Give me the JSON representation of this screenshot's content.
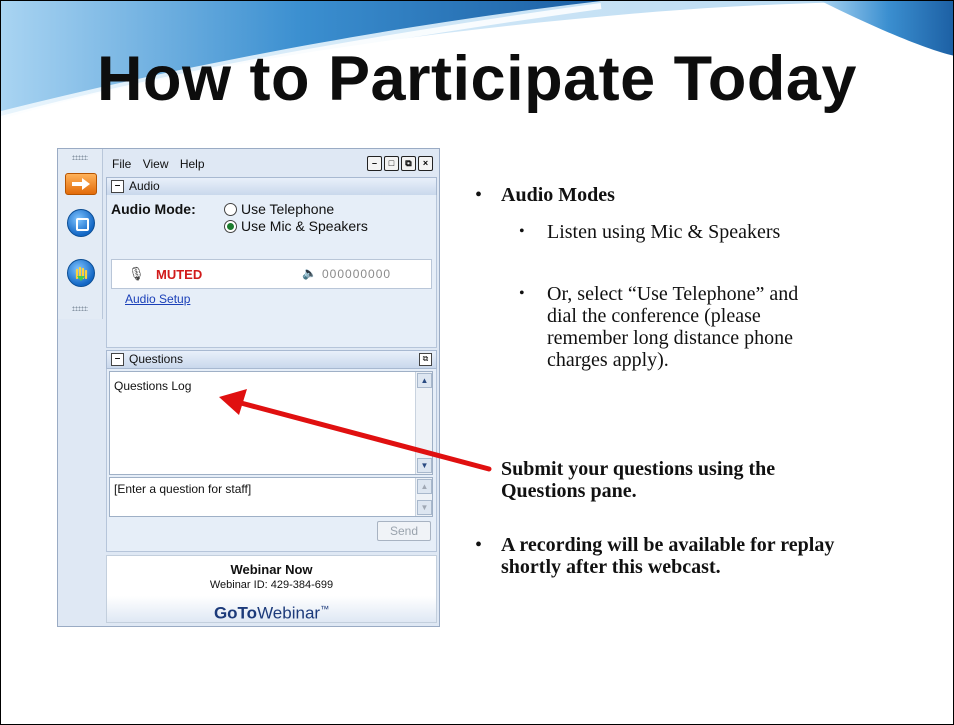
{
  "slide": {
    "title": "How to Participate Today"
  },
  "app": {
    "menu": [
      "File",
      "View",
      "Help"
    ],
    "window_buttons": [
      "minimize",
      "restore",
      "popout",
      "close"
    ],
    "audio_section": {
      "header": "Audio",
      "mode_label": "Audio Mode:",
      "options": [
        "Use Telephone",
        "Use Mic & Speakers"
      ],
      "selected_option": "Use Mic & Speakers",
      "mic_status": "MUTED",
      "pin": "000000000",
      "setup_link": "Audio Setup"
    },
    "questions_section": {
      "header": "Questions",
      "log_text": "Questions Log",
      "input_placeholder": "[Enter a question for staff]",
      "send_label": "Send"
    },
    "footer": {
      "status": "Webinar Now",
      "webinar_id": "Webinar ID: 429-384-699",
      "brand_bold": "GoTo",
      "brand_rest": "Webinar",
      "brand_tm": "™"
    }
  },
  "bullets": {
    "audio_modes": "Audio Modes",
    "sub1": "Listen using Mic & Speakers",
    "sub2": "Or, select “Use Telephone” and dial the conference (please remember long distance phone charges apply).",
    "questions": "Submit your questions using the Questions pane.",
    "recording": "A recording will be available for replay shortly after this webcast."
  },
  "colors": {
    "accent_wave": "#2f86c9",
    "muted_red": "#d11a1a",
    "arrow_red": "#e01010",
    "brand_blue": "#1c3a7a"
  }
}
